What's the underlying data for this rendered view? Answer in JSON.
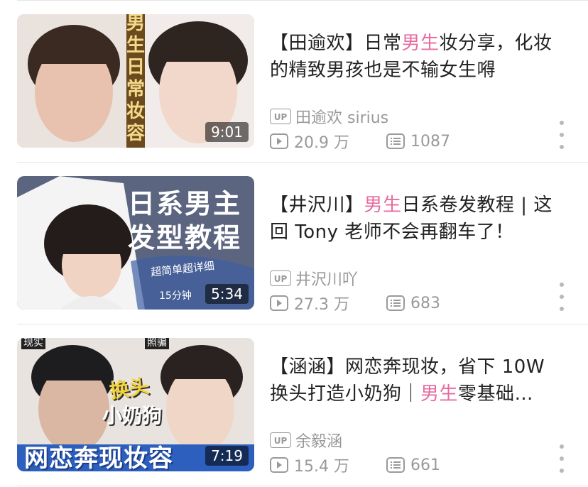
{
  "videos": [
    {
      "title_pre": "【田逾欢】日常",
      "title_hl": "男生",
      "title_post": "妆分享，化妆的精致男孩也是不输女生嘚",
      "uploader": "田逾欢 sirius",
      "views": "20.9 万",
      "danmaku": "1087",
      "duration": "9:01",
      "thumb_text": "男生日常妆容"
    },
    {
      "title_pre": "【井沢川】",
      "title_hl": "男生",
      "title_post": "日系卷发教程 | 这回 Tony 老师不会再翻车了！",
      "uploader": "井沢川吖",
      "views": "27.3 万",
      "danmaku": "683",
      "duration": "5:34",
      "thumb_line1": "日系男主",
      "thumb_line2": "发型教程",
      "thumb_sub1": "超简单超详细",
      "thumb_sub2": "15分钟"
    },
    {
      "title_pre": "【涵涵】网恋奔现妆，省下 10W 换头打造小奶狗｜",
      "title_hl": "男生",
      "title_post": "零基础…",
      "uploader": "余毅涵",
      "views": "15.4 万",
      "danmaku": "661",
      "duration": "7:19",
      "thumb_tag_left": "现实",
      "thumb_tag_right": "照骗",
      "thumb_mid1": "换头",
      "thumb_mid2": "小奶狗",
      "thumb_bottom": "网恋奔现妆容"
    }
  ],
  "labels": {
    "up_badge": "UP"
  },
  "colors": {
    "highlight": "#e86aa0",
    "meta": "#999999"
  },
  "icons": {
    "more": "more-vertical-icon",
    "play": "play-icon",
    "danmaku": "danmaku-icon"
  }
}
